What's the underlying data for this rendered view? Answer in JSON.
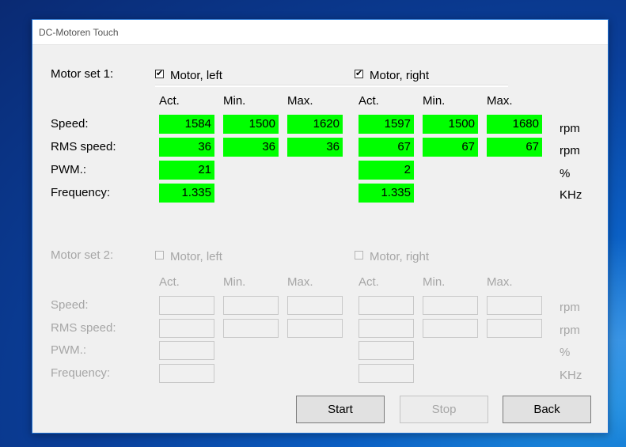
{
  "window": {
    "title": "DC-Motoren Touch"
  },
  "set1": {
    "label": "Motor set 1:",
    "left": {
      "label": "Motor, left",
      "checked": true
    },
    "right": {
      "label": "Motor, right",
      "checked": true
    },
    "col_headers": [
      "Act.",
      "Min.",
      "Max.",
      "Act.",
      "Min.",
      "Max."
    ],
    "rows": [
      {
        "label": "Speed:",
        "unit": "rpm",
        "left": [
          "1584",
          "1500",
          "1620"
        ],
        "right": [
          "1597",
          "1500",
          "1680"
        ]
      },
      {
        "label": "RMS speed:",
        "unit": "rpm",
        "left": [
          "36",
          "36",
          "36"
        ],
        "right": [
          "67",
          "67",
          "67"
        ]
      },
      {
        "label": "PWM.:",
        "unit": "%",
        "left": [
          "21"
        ],
        "right": [
          "2"
        ]
      },
      {
        "label": "Frequency:",
        "unit": "KHz",
        "left": [
          "1.335"
        ],
        "right": [
          "1.335"
        ]
      }
    ]
  },
  "set2": {
    "label": "Motor set 2:",
    "left": {
      "label": "Motor, left",
      "checked": false
    },
    "right": {
      "label": "Motor, right",
      "checked": false
    },
    "col_headers": [
      "Act.",
      "Min.",
      "Max.",
      "Act.",
      "Min.",
      "Max."
    ],
    "rows": [
      {
        "label": "Speed:",
        "unit": "rpm"
      },
      {
        "label": "RMS speed:",
        "unit": "rpm"
      },
      {
        "label": "PWM.:",
        "unit": "%"
      },
      {
        "label": "Frequency:",
        "unit": "KHz"
      }
    ]
  },
  "buttons": {
    "start": "Start",
    "stop": "Stop",
    "back": "Back"
  },
  "colors": {
    "active_field": "#00ff00",
    "accent": "#1e6fd0"
  }
}
